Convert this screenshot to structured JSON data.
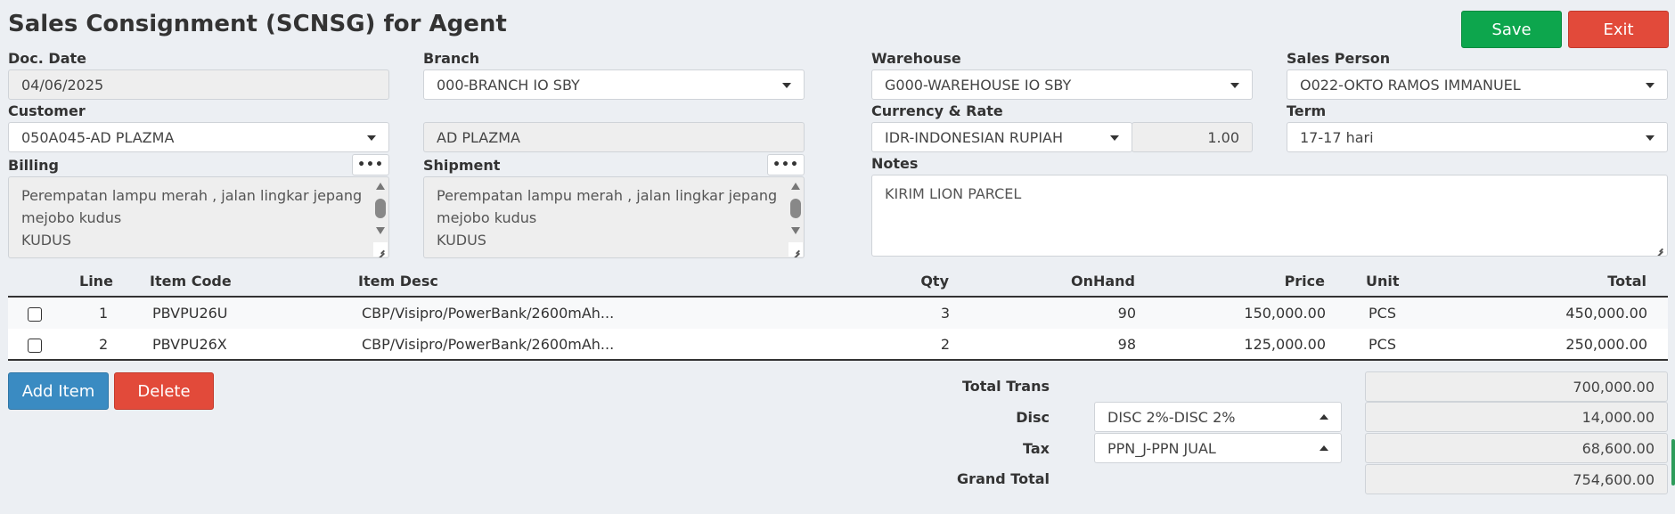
{
  "page": {
    "title": "Sales Consignment (SCNSG) for Agent"
  },
  "toolbar": {
    "save_label": "Save",
    "exit_label": "Exit"
  },
  "form": {
    "doc_date": {
      "label": "Doc. Date",
      "value": "04/06/2025"
    },
    "branch": {
      "label": "Branch",
      "value": "000-BRANCH IO SBY"
    },
    "warehouse": {
      "label": "Warehouse",
      "value": "G000-WAREHOUSE IO SBY"
    },
    "sales_person": {
      "label": "Sales Person",
      "value": "O022-OKTO RAMOS IMMANUEL"
    },
    "customer": {
      "label": "Customer",
      "value": "050A045-AD PLAZMA",
      "name": "AD PLAZMA"
    },
    "currency": {
      "label": "Currency & Rate",
      "value": "IDR-INDONESIAN RUPIAH",
      "rate": "1.00"
    },
    "term": {
      "label": "Term",
      "value": "17-17 hari"
    },
    "billing": {
      "label": "Billing",
      "more": "•••",
      "line1": "Perempatan lampu merah , jalan lingkar jepang",
      "line2": "mejobo kudus",
      "line3": "KUDUS"
    },
    "shipment": {
      "label": "Shipment",
      "more": "•••",
      "line1": "Perempatan lampu merah , jalan lingkar jepang",
      "line2": "mejobo kudus",
      "line3": "KUDUS"
    },
    "notes": {
      "label": "Notes",
      "value": "KIRIM LION PARCEL"
    }
  },
  "table": {
    "headers": {
      "line": "Line",
      "code": "Item Code",
      "desc": "Item Desc",
      "qty": "Qty",
      "onhand": "OnHand",
      "price": "Price",
      "unit": "Unit",
      "total": "Total"
    },
    "rows": [
      {
        "line": "1",
        "code": "PBVPU26U",
        "desc": "CBP/Visipro/PowerBank/2600mAh...",
        "qty": "3",
        "onhand": "90",
        "price": "150,000.00",
        "unit": "PCS",
        "total": "450,000.00"
      },
      {
        "line": "2",
        "code": "PBVPU26X",
        "desc": "CBP/Visipro/PowerBank/2600mAh...",
        "qty": "2",
        "onhand": "98",
        "price": "125,000.00",
        "unit": "PCS",
        "total": "250,000.00"
      }
    ]
  },
  "actions": {
    "add_label": "Add Item",
    "delete_label": "Delete"
  },
  "totals": {
    "total_trans": {
      "label": "Total Trans",
      "value": "700,000.00"
    },
    "disc": {
      "label": "Disc",
      "option": "DISC 2%-DISC 2%",
      "value": "14,000.00"
    },
    "tax": {
      "label": "Tax",
      "option": "PPN_J-PPN JUAL",
      "value": "68,600.00"
    },
    "grand_total": {
      "label": "Grand Total",
      "value": "754,600.00"
    }
  }
}
